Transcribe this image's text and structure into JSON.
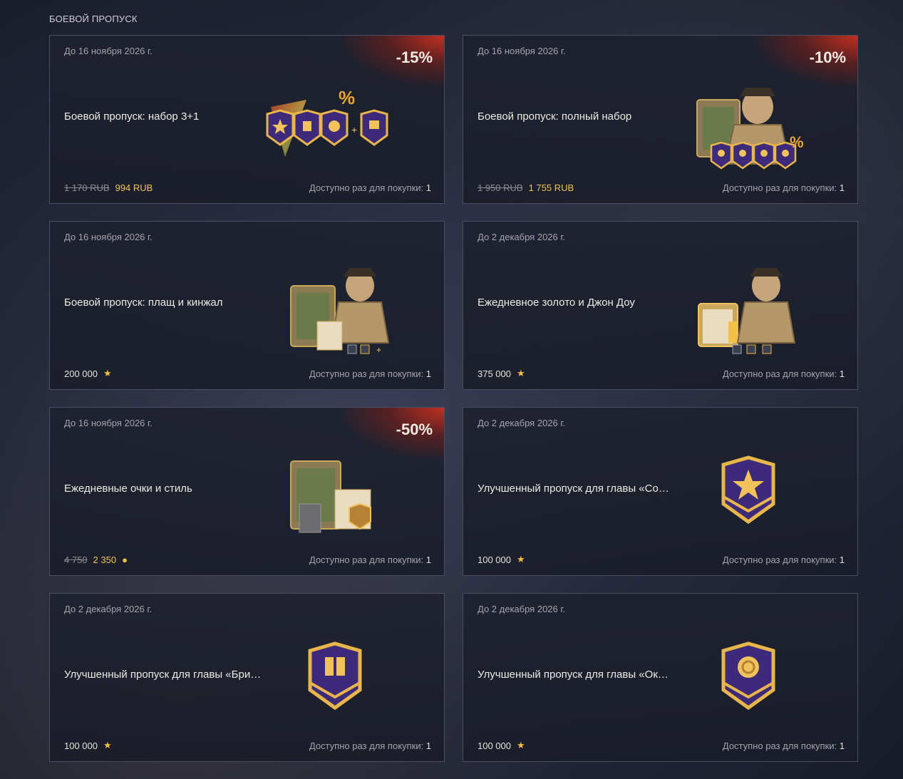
{
  "section_title": "БОЕВОЙ ПРОПУСК",
  "availability_label": "Доступно раз для покупки:",
  "cards": [
    {
      "date": "До 16 ноября 2026 г.",
      "title": "Боевой пропуск: набор 3+1",
      "discount": "-15%",
      "old_price": "1 170 RUB",
      "new_price": "994 RUB",
      "available": "1"
    },
    {
      "date": "До 16 ноября 2026 г.",
      "title": "Боевой пропуск: полный набор",
      "discount": "-10%",
      "old_price": "1 950 RUB",
      "new_price": "1 755 RUB",
      "available": "1"
    },
    {
      "date": "До 16 ноября 2026 г.",
      "title": "Боевой пропуск: плащ и кинжал",
      "price": "200 000",
      "currency_icon": "star-icon",
      "available": "1"
    },
    {
      "date": "До 2 декабря 2026 г.",
      "title": "Ежедневное золото и Джон Доу",
      "price": "375 000",
      "currency_icon": "star-icon",
      "available": "1"
    },
    {
      "date": "До 16 ноября 2026 г.",
      "title": "Ежедневные очки и стиль",
      "discount": "-50%",
      "old_price": "4 750",
      "new_price": "2 350",
      "currency_icon": "gold-icon",
      "available": "1"
    },
    {
      "date": "До 2 декабря 2026 г.",
      "title": "Улучшенный пропуск для главы «Со…",
      "price": "100 000",
      "currency_icon": "star-icon",
      "available": "1"
    },
    {
      "date": "До 2 декабря 2026 г.",
      "title": "Улучшенный пропуск для главы «Бри…",
      "price": "100 000",
      "currency_icon": "star-icon",
      "available": "1"
    },
    {
      "date": "До 2 декабря 2026 г.",
      "title": "Улучшенный пропуск для главы «Ок…",
      "price": "100 000",
      "currency_icon": "star-icon",
      "available": "1"
    }
  ],
  "colors": {
    "accent_gold": "#f1c35a",
    "badge_purple": "#3d2a7a",
    "discount_red": "#c8321e"
  }
}
